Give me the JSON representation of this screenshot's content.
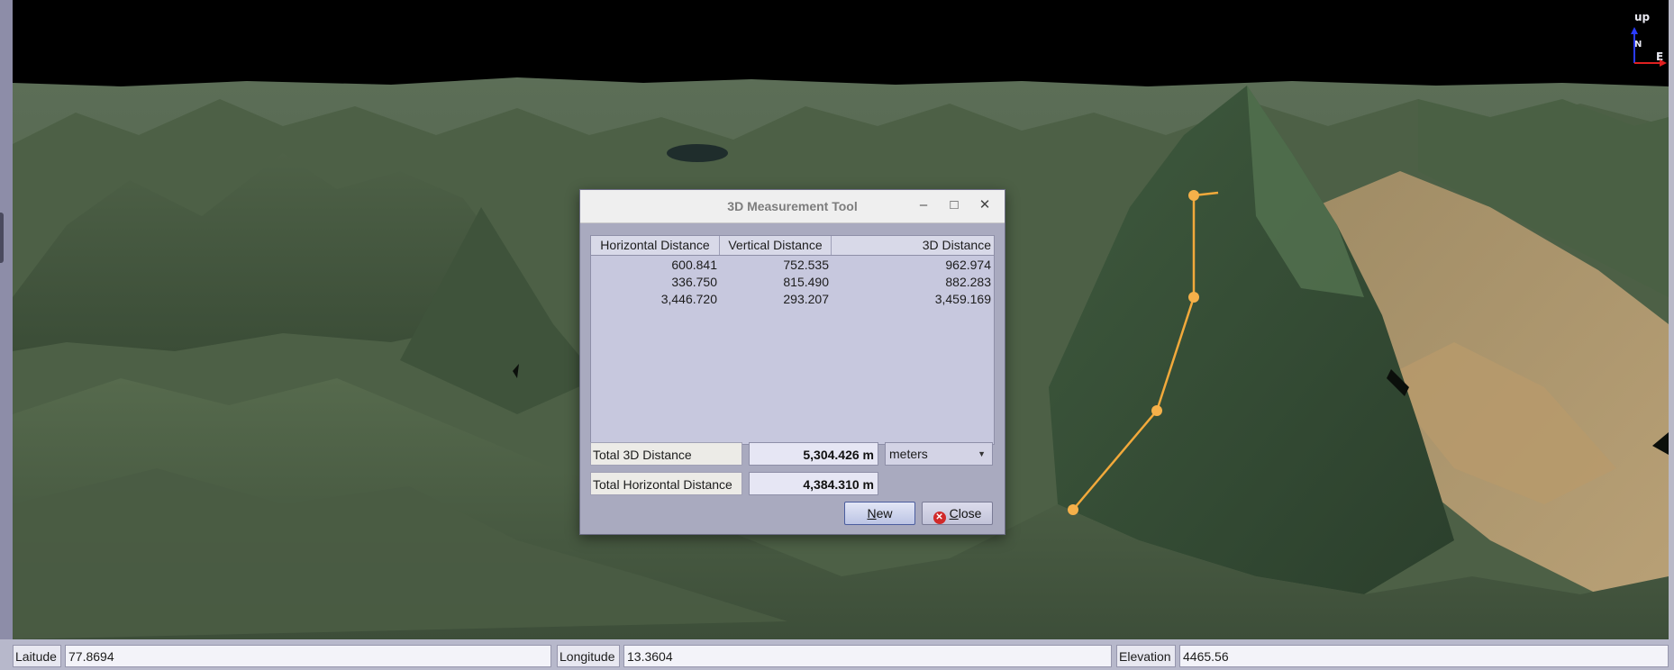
{
  "viewport": {
    "compass": {
      "up": "up",
      "north": "N",
      "east": "E"
    }
  },
  "dialog": {
    "title": "3D Measurement Tool",
    "window_controls": {
      "minimize": "–",
      "maximize": "□",
      "close": "✕"
    },
    "table": {
      "headers": [
        "Horizontal Distance",
        "Vertical Distance",
        "3D Distance"
      ],
      "rows": [
        [
          "600.841",
          "752.535",
          "962.974"
        ],
        [
          "336.750",
          "815.490",
          "882.283"
        ],
        [
          "3,446.720",
          "293.207",
          "3,459.169"
        ]
      ]
    },
    "total_3d": {
      "label": "Total 3D Distance",
      "value": "5,304.426 m"
    },
    "total_horizontal": {
      "label": "Total Horizontal Distance",
      "value": "4,384.310 m"
    },
    "unit_select": {
      "selected": "meters"
    },
    "buttons": {
      "new_mnemonic": "N",
      "new_rest": "ew",
      "close_mnemonic": "C",
      "close_rest": "lose"
    }
  },
  "statusbar": {
    "latitude": {
      "label": "Laitude",
      "value": "77.8694"
    },
    "longitude": {
      "label": "Longitude",
      "value": "13.3604"
    },
    "elevation": {
      "label": "Elevation",
      "value": "4465.56"
    }
  },
  "colors": {
    "sky": "#000000",
    "terrain_dark": "#2f4331",
    "terrain_mid": "#4f6448",
    "terrain_tan": "#b39a70",
    "measure_line": "#f2a93b"
  }
}
